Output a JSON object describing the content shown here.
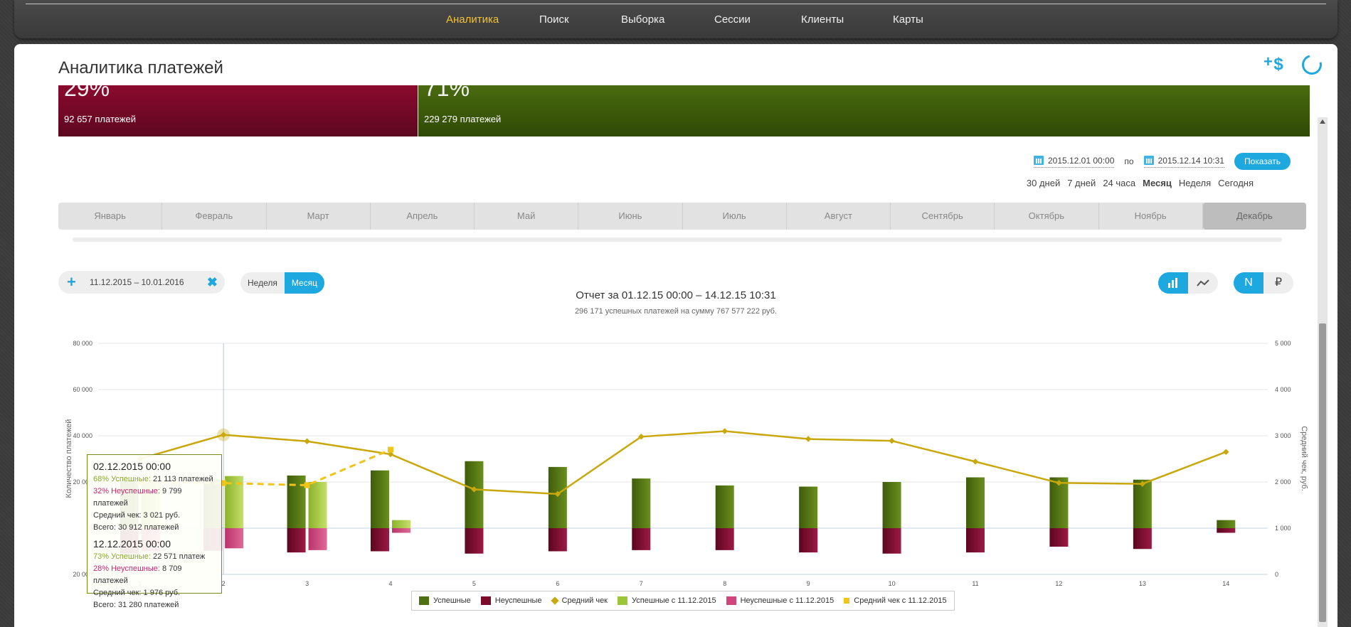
{
  "nav": {
    "items": [
      "Аналитика",
      "Поиск",
      "Выборка",
      "Сессии",
      "Клиенты",
      "Карты"
    ],
    "active": 0
  },
  "page": {
    "title": "Аналитика платежей"
  },
  "summary": {
    "fail": {
      "pct": "29%",
      "count": "92 657 платежей",
      "share": 29,
      "color": "#7a0a2a"
    },
    "ok": {
      "pct": "71%",
      "count": "229 279 платежей",
      "share": 71,
      "color": "#3f5c0a"
    }
  },
  "dates": {
    "from": "2015.12.01 00:00",
    "sep": "по",
    "to": "2015.12.14 10:31",
    "show_label": "Показать",
    "periods": [
      "30 дней",
      "7 дней",
      "24 часа",
      "Месяц",
      "Неделя",
      "Сегодня"
    ],
    "period_selected": 3
  },
  "months": {
    "items": [
      "Январь",
      "Февраль",
      "Март",
      "Апрель",
      "Май",
      "Июнь",
      "Июль",
      "Август",
      "Сентябрь",
      "Октябрь",
      "Ноябрь",
      "Декабрь"
    ],
    "selected": 11
  },
  "compare": {
    "range": "11.12.2015 – 10.01.2016"
  },
  "toggle_period": {
    "items": [
      "Неделя",
      "Месяц"
    ],
    "selected": 1
  },
  "toggle_type": {
    "icons": [
      "bar-chart-icon",
      "line-chart-icon"
    ],
    "selected": 0
  },
  "toggle_unit": {
    "items": [
      "N",
      "₽"
    ],
    "selected": 0
  },
  "chart_data": {
    "type": "bar",
    "title": "Отчет за 01.12.15 00:00 – 14.12.15 10:31",
    "subtitle": "296 171 успешных платежей на сумму 767 577 222 руб.",
    "ylabel": "Количество платежей",
    "y2label": "Средний чек, руб.",
    "yticks": [
      "80 000",
      "60 000",
      "40 000",
      "20 000",
      "0",
      "20 000"
    ],
    "y2ticks": [
      "5 000",
      "4 000",
      "3 000",
      "2 000",
      "1 000",
      "0"
    ],
    "ylim": [
      -20000,
      80000
    ],
    "y2lim": [
      0,
      5000
    ],
    "categories": [
      "1",
      "2",
      "3",
      "4",
      "5",
      "6",
      "7",
      "8",
      "9",
      "10",
      "11",
      "12",
      "13",
      "14"
    ],
    "series": [
      {
        "name": "Успешные",
        "kind": "bar",
        "axis": "left",
        "color": "#4f7010",
        "values": [
          20500,
          21113,
          22800,
          25000,
          29000,
          26500,
          21500,
          18500,
          18000,
          20000,
          22000,
          22000,
          21000,
          3500
        ]
      },
      {
        "name": "Неуспешные",
        "kind": "bar",
        "axis": "left",
        "color": "#7a0a2a",
        "values": [
          -11000,
          -9799,
          -10500,
          -10000,
          -11000,
          -10000,
          -9500,
          -9500,
          -10500,
          -11000,
          -10500,
          -8000,
          -9000,
          -2000
        ]
      },
      {
        "name": "Средний чек",
        "kind": "line",
        "axis": "right",
        "color": "#c8a80c",
        "values": [
          2500,
          3021,
          2880,
          2600,
          1840,
          1740,
          2980,
          3100,
          2930,
          2890,
          2440,
          1980,
          1960,
          2650
        ]
      },
      {
        "name": "Успешные с 11.12.2015",
        "kind": "bar",
        "axis": "left",
        "color": "#9cc53a",
        "values": [
          20000,
          22571,
          20000,
          3500,
          null,
          null,
          null,
          null,
          null,
          null,
          null,
          null,
          null,
          null
        ]
      },
      {
        "name": "Неуспешные с 11.12.2015",
        "kind": "bar",
        "axis": "left",
        "color": "#d0457c",
        "values": [
          -10000,
          -8709,
          -9500,
          -2000,
          null,
          null,
          null,
          null,
          null,
          null,
          null,
          null,
          null,
          null
        ]
      },
      {
        "name": "Средний чек с 11.12.2015",
        "kind": "line-dashed",
        "axis": "right",
        "color": "#f0c419",
        "values": [
          2000,
          1976,
          1930,
          2700,
          null,
          null,
          null,
          null,
          null,
          null,
          null,
          null,
          null,
          null
        ]
      }
    ]
  },
  "tooltip": {
    "a": {
      "date": "02.12.2015 00:00",
      "ok": "68% Успешные:",
      "ok_val": "21 113 платежей",
      "fail": "32% Неуспешные:",
      "fail_val": "9 799 платежей",
      "avg": "Средний чек: 3 021 руб.",
      "total": "Всего: 30 912 платежей"
    },
    "b": {
      "date": "12.12.2015 00:00",
      "ok": "73% Успешные:",
      "ok_val": "22 571 платеж",
      "fail": "28% Неуспешные:",
      "fail_val": "8 709 платежей",
      "avg": "Средний чек: 1 976 руб.",
      "total": "Всего: 31 280 платежей"
    }
  }
}
